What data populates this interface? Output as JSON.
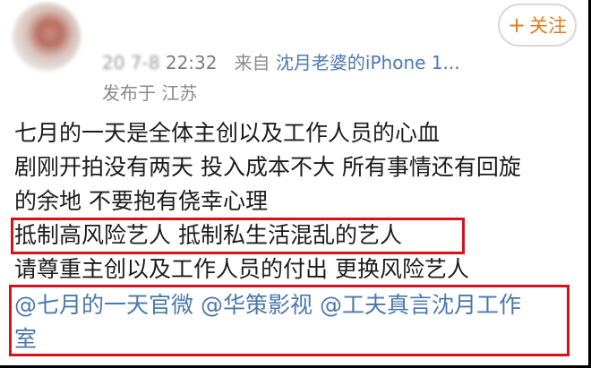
{
  "header": {
    "date_prefix_blurred": "20  7-8",
    "time": "22:32",
    "source_prefix": "来自",
    "device": "沈月老婆的iPhone 1...",
    "location": "发布于 江苏",
    "follow_label": "关注",
    "follow_icon": "plus-icon"
  },
  "post": {
    "lines": [
      "七月的一天是全体主创以及工作人员的心血",
      "剧刚开拍没有两天 投入成本不大 所有事情还有回旋",
      "的余地 不要抱有侥幸心理",
      "抵制高风险艺人 抵制私生活混乱的艺人",
      "请尊重主创以及工作人员的付出 更换风险艺人"
    ],
    "mentions_line1": [
      "@七月的一天官微",
      "@华策影视",
      "@工夫真言沈月工作"
    ],
    "mentions_line2": "室"
  },
  "colors": {
    "highlight": "#d8101a",
    "link": "#4a78ad",
    "follow": "#e07b1a",
    "meta": "#8a8a8a"
  }
}
